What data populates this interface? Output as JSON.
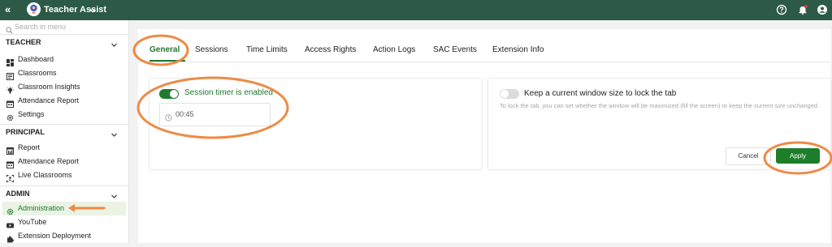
{
  "app": {
    "title": "Teacher Assist",
    "collapse_glyph": "«"
  },
  "sidebar": {
    "search_placeholder": "Search in menu",
    "sections": [
      {
        "title": "TEACHER",
        "items": [
          {
            "label": "Dashboard",
            "icon": "dashboard-icon"
          },
          {
            "label": "Classrooms",
            "icon": "classrooms-icon"
          },
          {
            "label": "Classroom Insights",
            "icon": "insights-icon"
          },
          {
            "label": "Attendance Report",
            "icon": "attendance-report-icon"
          },
          {
            "label": "Settings",
            "icon": "gear-icon"
          }
        ]
      },
      {
        "title": "PRINCIPAL",
        "items": [
          {
            "label": "Report",
            "icon": "report-icon"
          },
          {
            "label": "Attendance Report",
            "icon": "attendance-report-icon"
          },
          {
            "label": "Live Classrooms",
            "icon": "live-classrooms-icon"
          }
        ]
      },
      {
        "title": "ADMIN",
        "items": [
          {
            "label": "Administration",
            "icon": "gear-icon",
            "active": true
          },
          {
            "label": "YouTube",
            "icon": "youtube-icon"
          },
          {
            "label": "Extension Deployment",
            "icon": "puzzle-icon"
          }
        ]
      }
    ]
  },
  "tabs": [
    {
      "label": "General",
      "active": true
    },
    {
      "label": "Sessions"
    },
    {
      "label": "Time Limits"
    },
    {
      "label": "Access Rights"
    },
    {
      "label": "Action Logs"
    },
    {
      "label": "SAC Events"
    },
    {
      "label": "Extension Info"
    }
  ],
  "session_timer": {
    "label": "Session timer is enabled",
    "enabled": true,
    "value": "00:45"
  },
  "window_lock": {
    "label": "Keep a current window size to lock the tab",
    "enabled": false,
    "description": "To lock the tab, you can set whether the window will be maximized (fill the screen) or keep the current size unchanged."
  },
  "actions": {
    "cancel_label": "Cancel",
    "apply_label": "Apply"
  },
  "colors": {
    "topbar": "#2c5a46",
    "accent_green": "#1f7a2f",
    "annotation_orange": "#ee8a45",
    "active_nav_bg": "#eaf3e4"
  }
}
